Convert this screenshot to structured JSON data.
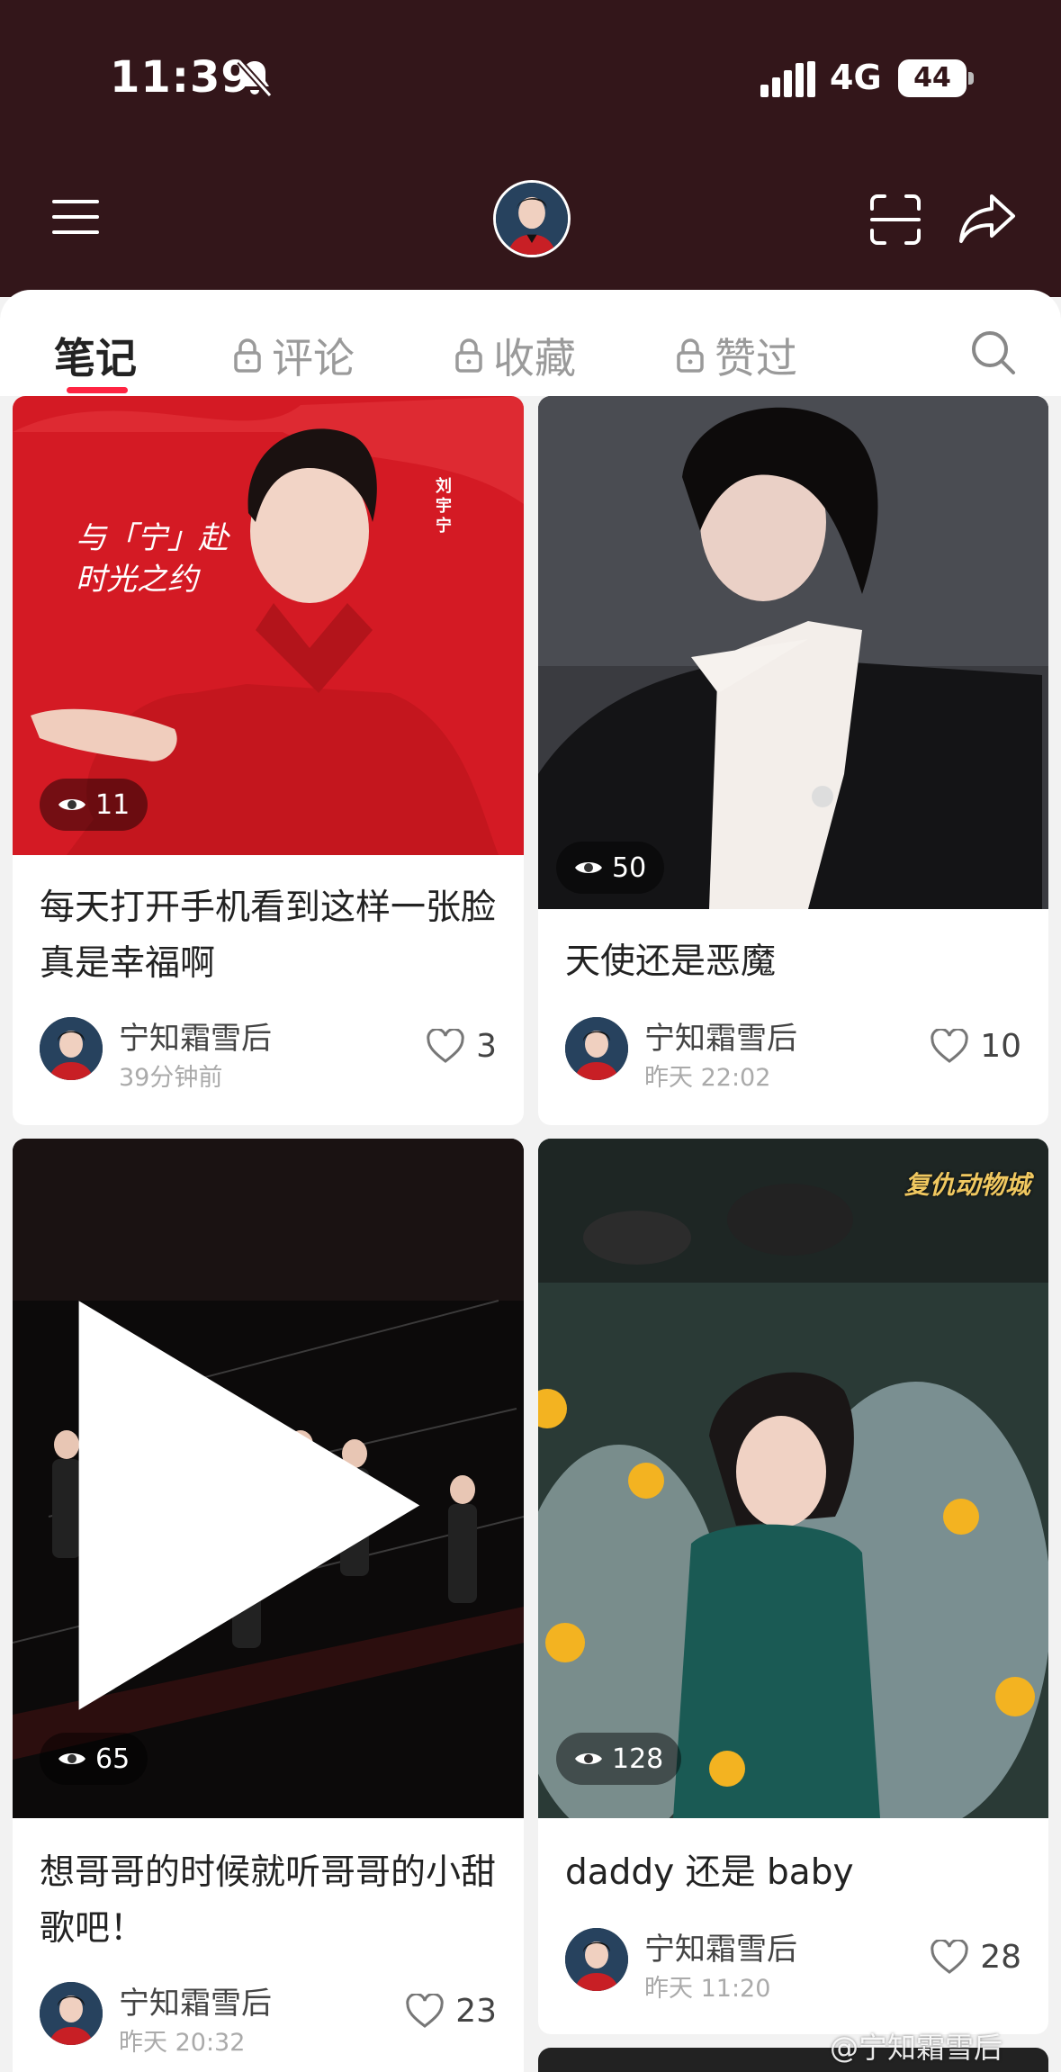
{
  "status_bar": {
    "time": "11:39",
    "network": "4G",
    "battery": "44"
  },
  "tabs": [
    {
      "label": "笔记",
      "locked": false,
      "active": true
    },
    {
      "label": "评论",
      "locked": true,
      "active": false
    },
    {
      "label": "收藏",
      "locked": true,
      "active": false
    },
    {
      "label": "赞过",
      "locked": true,
      "active": false
    }
  ],
  "notes": [
    {
      "cover_text": "与「宁」赴时光之约",
      "cover_tag": "刘宇宁",
      "views": "11",
      "title": "每天打开手机看到这样一张脸真是幸福啊",
      "author": "宁知霜雪后",
      "time": "39分钟前",
      "likes": "3"
    },
    {
      "views": "50",
      "title": "天使还是恶魔",
      "author": "宁知霜雪后",
      "time": "昨天 22:02",
      "likes": "10"
    },
    {
      "views": "65",
      "title": "想哥哥的时候就听哥哥的小甜歌吧！",
      "author": "宁知霜雪后",
      "time": "昨天 20:32",
      "likes": "23",
      "is_video": true
    },
    {
      "cover_text": "复仇动物城",
      "views": "128",
      "title": "daddy 还是 baby",
      "author": "宁知霜雪后",
      "time": "昨天 11:20",
      "likes": "28"
    }
  ],
  "watermark": "@宁知霜雪后",
  "colors": {
    "header_bg": "#33161a",
    "accent": "#ff2442"
  }
}
